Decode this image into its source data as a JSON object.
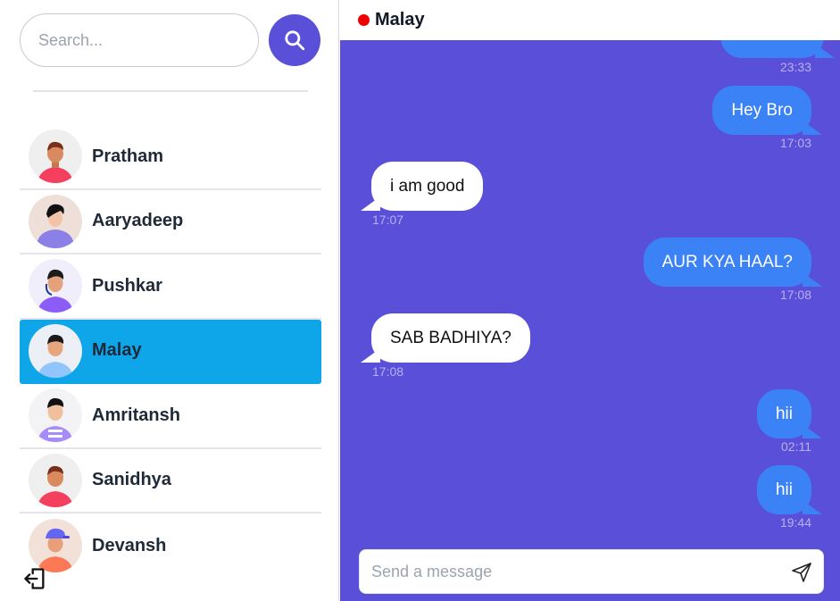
{
  "sidebar": {
    "search_placeholder": "Search...",
    "contacts": [
      {
        "name": "Pratham",
        "avatar": "avatar-red-shirt",
        "active": false
      },
      {
        "name": "Aaryadeep",
        "avatar": "avatar-purple-hoodie",
        "active": false
      },
      {
        "name": "Pushkar",
        "avatar": "avatar-headset",
        "active": false
      },
      {
        "name": "Malay",
        "avatar": "avatar-blue-shirt",
        "active": true
      },
      {
        "name": "Amritansh",
        "avatar": "avatar-striped-shirt",
        "active": false
      },
      {
        "name": "Sanidhya",
        "avatar": "avatar-red-shirt",
        "active": false
      },
      {
        "name": "Devansh",
        "avatar": "avatar-blue-cap",
        "active": false
      }
    ]
  },
  "chat": {
    "title": "Malay",
    "status_color": "#ef0000",
    "messages": [
      {
        "text": "",
        "time": "23:33",
        "direction": "out"
      },
      {
        "text": "Hey Bro",
        "time": "17:03",
        "direction": "out"
      },
      {
        "text": "i am good",
        "time": "17:07",
        "direction": "in"
      },
      {
        "text": "AUR KYA HAAL?",
        "time": "17:08",
        "direction": "out"
      },
      {
        "text": "SAB BADHIYA?",
        "time": "17:08",
        "direction": "in"
      },
      {
        "text": "hii",
        "time": "02:11",
        "direction": "out"
      },
      {
        "text": "hii",
        "time": "19:44",
        "direction": "out"
      }
    ],
    "composer_placeholder": "Send a message"
  },
  "colors": {
    "accent": "#5a4fd8",
    "active_contact": "#0ea5e9",
    "outgoing_bubble": "#3b82f6",
    "incoming_bubble": "#ffffff"
  }
}
